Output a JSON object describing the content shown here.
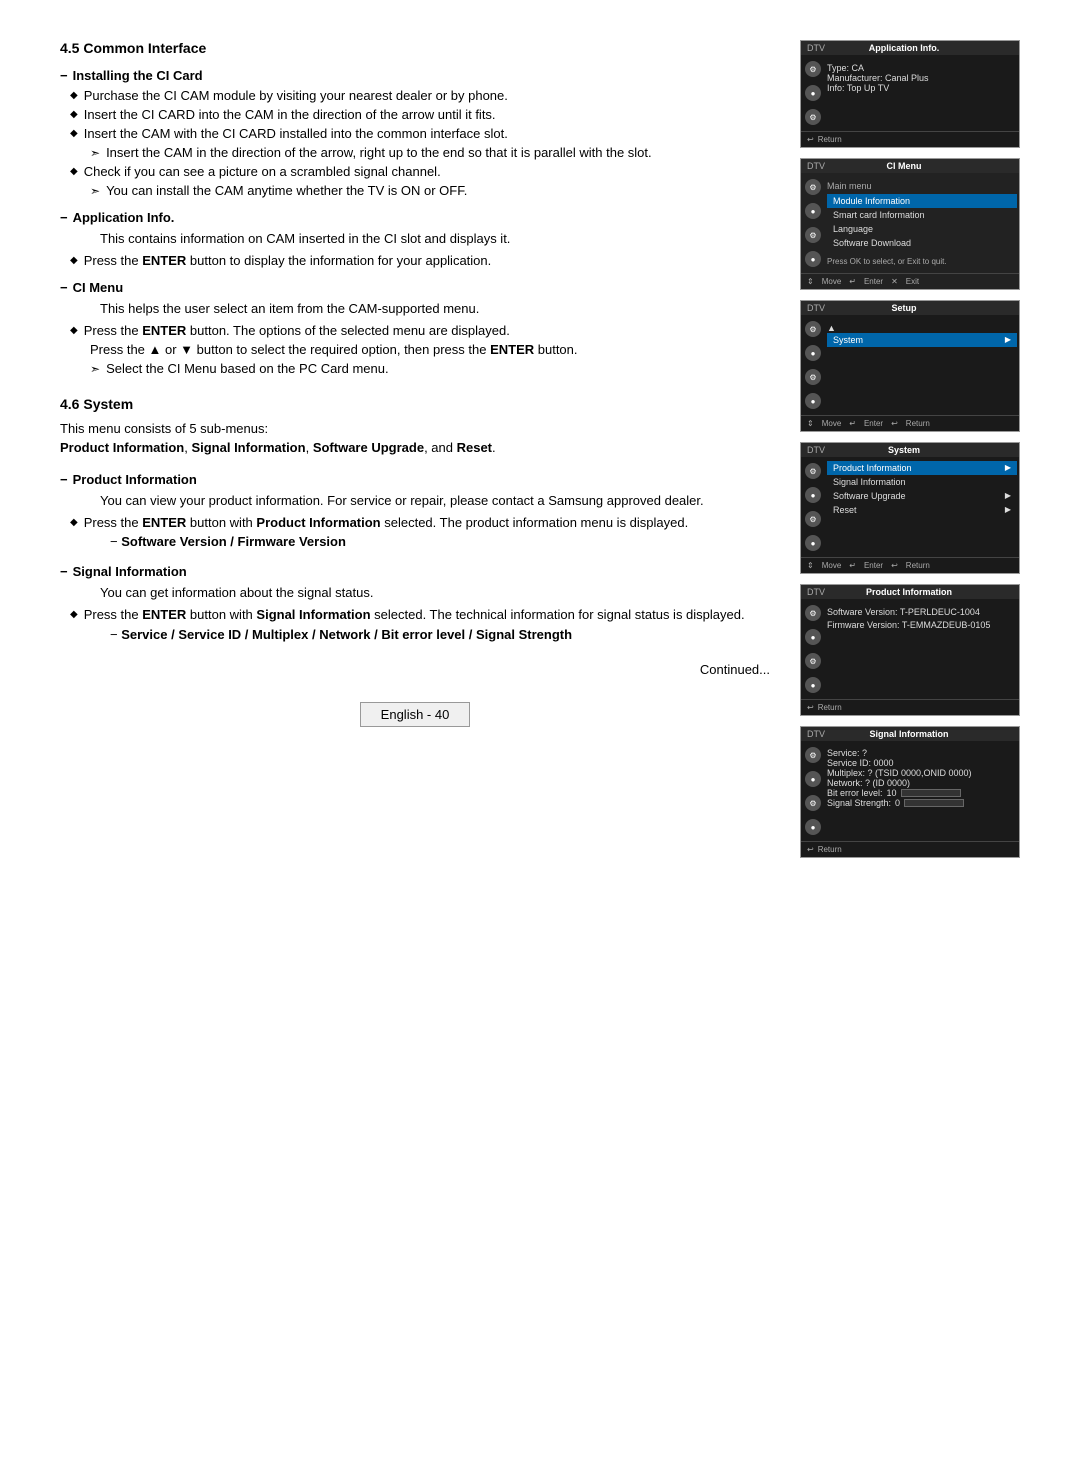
{
  "sections": {
    "common_interface": {
      "heading": "4.5  Common Interface",
      "installing_ci_card": {
        "label": "Installing the CI Card",
        "bullets": [
          "Purchase the CI CAM module by visiting your nearest dealer or by phone.",
          "Insert the CI CARD into the CAM in the direction of the arrow until it fits.",
          "Insert the CAM with the CI CARD installed into the common interface slot."
        ],
        "arrow_items": [
          "Insert the CAM in the direction of the arrow, right up to the end so that it is parallel with the slot."
        ],
        "bullets2": [
          "Check if you can see a picture on a scrambled signal channel."
        ],
        "arrow_items2": [
          "You can install the CAM anytime whether the TV is ON or OFF."
        ]
      },
      "application_info": {
        "label": "Application Info.",
        "description": "This contains information on CAM inserted in the CI slot and displays it.",
        "bullets": [
          "Press the ENTER button to display the information for your application."
        ]
      },
      "ci_menu": {
        "label": "CI Menu",
        "description": "This helps the user select an item from the CAM-supported menu.",
        "bullets": [
          "Press the ENTER button. The options of the selected menu are displayed.",
          "Press the ▲ or ▼ button to select the required option, then press the ENTER button."
        ],
        "arrow_items": [
          "Select the CI Menu based on the PC Card menu."
        ]
      }
    },
    "system": {
      "heading": "4.6  System",
      "description": "This menu consists of 5 sub-menus:",
      "sub_menus_bold": "Product Information, Signal Information, Software Upgrade, and Reset.",
      "product_info": {
        "label": "Product Information",
        "description": "You can view your product information. For service or repair, please contact a Samsung approved dealer.",
        "bullets": [
          "Press the ENTER button with Product Information selected. The product information menu is displayed."
        ],
        "sub_dash": "Software Version / Firmware Version"
      },
      "signal_info": {
        "label": "Signal Information",
        "description": "You can get information about the signal status.",
        "bullets": [
          "Press the ENTER button with Signal Information selected. The technical information for signal status is displayed."
        ],
        "sub_dash": "Service / Service ID / Multiplex / Network / Bit error level / Signal Strength"
      }
    }
  },
  "panels": {
    "application_info": {
      "title": "Application Info.",
      "dtv": "DTV",
      "type": "Type: CA",
      "manufacturer": "Manufacturer: Canal Plus",
      "info": "Info: Top Up TV",
      "return": "Return"
    },
    "ci_menu": {
      "title": "CI Menu",
      "dtv": "DTV",
      "main_menu": "Main menu",
      "items": [
        {
          "label": "Module Information",
          "highlighted": true
        },
        {
          "label": "Smart card Information",
          "highlighted": false
        },
        {
          "label": "Language",
          "highlighted": false
        },
        {
          "label": "Software Download",
          "highlighted": false
        }
      ],
      "instruction": "Press OK to select, or Exit to quit.",
      "nav": {
        "move": "Move",
        "enter": "Enter",
        "exit": "Exit"
      }
    },
    "setup": {
      "title": "Setup",
      "dtv": "DTV",
      "up_arrow": "▲",
      "item": "System",
      "nav": {
        "move": "Move",
        "enter": "Enter",
        "return": "Return"
      }
    },
    "system_menu": {
      "title": "System",
      "dtv": "DTV",
      "items": [
        {
          "label": "Product Information",
          "has_arrow": true
        },
        {
          "label": "Signal Information",
          "has_arrow": false
        },
        {
          "label": "Software Upgrade",
          "has_arrow": true
        },
        {
          "label": "Reset",
          "has_arrow": true
        }
      ],
      "nav": {
        "move": "Move",
        "enter": "Enter",
        "return": "Return"
      }
    },
    "product_info": {
      "title": "Product Information",
      "dtv": "DTV",
      "software_version": "Software Version: T-PERLDEUC-1004",
      "firmware_version": "Firmware Version: T-EMMAZDEUB-0105",
      "return": "Return"
    },
    "signal_info": {
      "title": "Signal Information",
      "dtv": "DTV",
      "service": "Service: ?",
      "service_id": "Service ID: 0000",
      "multiplex": "Multiplex: ? (TSID 0000,ONID 0000)",
      "network": "Network: ? (ID 0000)",
      "bit_error_label": "Bit error level:",
      "bit_error_value": "10",
      "signal_strength_label": "Signal Strength:",
      "signal_strength_value": "0",
      "return": "Return"
    }
  },
  "footer": {
    "continued": "Continued...",
    "page_label": "English - 40"
  }
}
